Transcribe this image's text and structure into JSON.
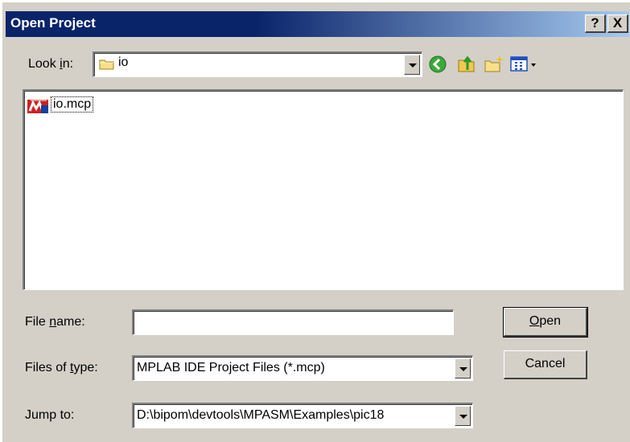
{
  "window": {
    "title": "Open Project",
    "help_button": "?",
    "close_button": "X"
  },
  "toolbar": {
    "look_in_label_pre": "Look ",
    "look_in_label_accel": "i",
    "look_in_label_post": "n:",
    "look_in_value": "io",
    "icons": [
      "back-icon",
      "up-folder-icon",
      "new-folder-icon",
      "view-menu-icon"
    ]
  },
  "file_list": {
    "items": [
      {
        "name": "io.mcp",
        "icon": "mplab-project-icon"
      }
    ]
  },
  "form": {
    "file_name_label_pre": "File ",
    "file_name_label_accel": "n",
    "file_name_label_post": "ame:",
    "file_name_value": "",
    "files_of_type_label_pre": "Files of ",
    "files_of_type_label_accel": "t",
    "files_of_type_label_post": "ype:",
    "files_of_type_value": "MPLAB IDE Project Files (*.mcp)",
    "jump_to_label": "Jump to:",
    "jump_to_value": "D:\\bipom\\devtools\\MPASM\\Examples\\pic18"
  },
  "buttons": {
    "open_accel": "O",
    "open_rest": "pen",
    "cancel": "Cancel"
  },
  "colors": {
    "titlebar_start": "#0a246a",
    "titlebar_end": "#a6caf0",
    "dialog_face": "#d4d0c8"
  }
}
